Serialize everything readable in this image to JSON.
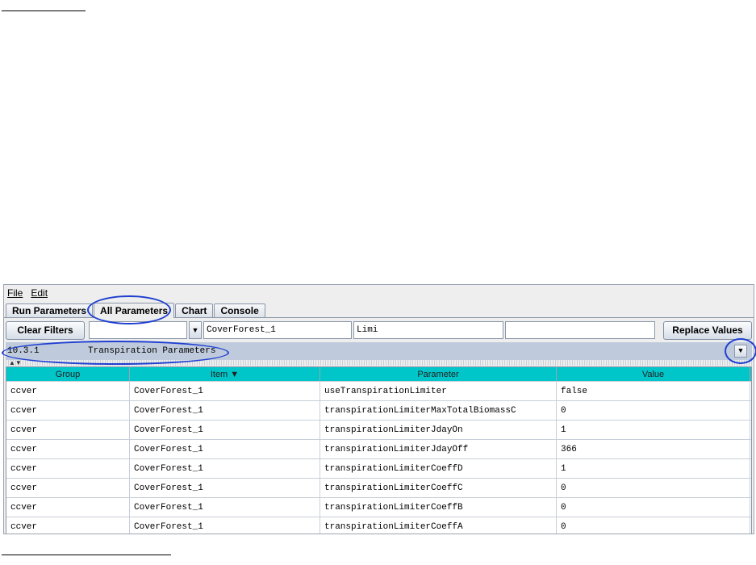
{
  "menu": {
    "file": "File",
    "edit": "Edit"
  },
  "tabs": [
    {
      "label": "Run Parameters",
      "active": false
    },
    {
      "label": "All Parameters",
      "active": true
    },
    {
      "label": "Chart",
      "active": false
    },
    {
      "label": "Console",
      "active": false
    }
  ],
  "filters": {
    "clear_label": "Clear Filters",
    "group_value": "",
    "item_value": "CoverForest_1",
    "parameter_value": "Limi",
    "value_value": "",
    "replace_label": "Replace Values"
  },
  "section": {
    "number": "10.3.1",
    "title": "Transpiration Parameters"
  },
  "table": {
    "columns": [
      "Group",
      "Item ▼",
      "Parameter",
      "Value"
    ],
    "rows": [
      [
        "ccver",
        "CoverForest_1",
        "useTranspirationLimiter",
        "false"
      ],
      [
        "ccver",
        "CoverForest_1",
        "transpirationLimiterMaxTotalBiomassC",
        "0"
      ],
      [
        "ccver",
        "CoverForest_1",
        "transpirationLimiterJdayOn",
        "1"
      ],
      [
        "ccver",
        "CoverForest_1",
        "transpirationLimiterJdayOff",
        "366"
      ],
      [
        "ccver",
        "CoverForest_1",
        "transpirationLimiterCoeffD",
        "1"
      ],
      [
        "ccver",
        "CoverForest_1",
        "transpirationLimiterCoeffC",
        "0"
      ],
      [
        "ccver",
        "CoverForest_1",
        "transpirationLimiterCoeffB",
        "0"
      ],
      [
        "ccver",
        "CoverForest_1",
        "transpirationLimiterCoeffA",
        "0"
      ]
    ]
  },
  "colors": {
    "header_teal": "#00c6c9",
    "section_bar": "#bfcbdc",
    "annotation_ink": "#1f3fd0"
  }
}
